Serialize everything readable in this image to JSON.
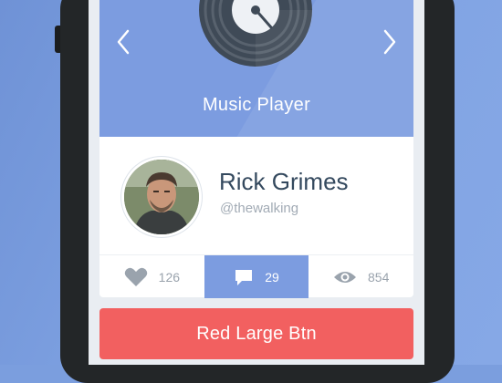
{
  "header": {
    "title": "Music Player",
    "prev_icon": "chevron-left-icon",
    "next_icon": "chevron-right-icon",
    "artwork_icon": "vinyl-record-icon",
    "color": "#7c9ce0"
  },
  "profile": {
    "name": "Rick Grimes",
    "handle": "@thewalking",
    "name_color": "#34495e"
  },
  "stats": [
    {
      "icon": "heart-icon",
      "value": "126",
      "active": false
    },
    {
      "icon": "comment-icon",
      "value": "29",
      "active": true
    },
    {
      "icon": "eye-icon",
      "value": "854",
      "active": false
    }
  ],
  "button": {
    "label": "Red Large Btn",
    "color": "#f26060"
  }
}
